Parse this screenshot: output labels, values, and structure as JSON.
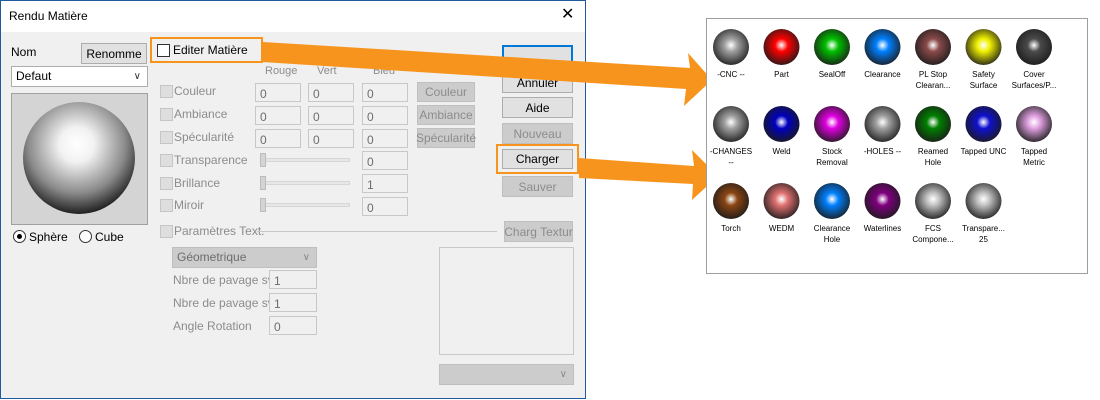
{
  "dialog": {
    "title": "Rendu Matière",
    "close_glyph": "✕",
    "name_label": "Nom",
    "rename_button": "Renomme",
    "name_select_value": "Defaut",
    "edit_checkbox_label": "Editer Matière",
    "col_headers": [
      "Rouge",
      "Vert",
      "Bleu"
    ],
    "rows": [
      {
        "label": "Couleur",
        "values": [
          "0",
          "0",
          "0"
        ],
        "button": "Couleur"
      },
      {
        "label": "Ambiance",
        "values": [
          "0",
          "0",
          "0"
        ],
        "button": "Ambiance"
      },
      {
        "label": "Spécularité",
        "values": [
          "0",
          "0",
          "0"
        ],
        "button": "Spécularité"
      }
    ],
    "sliders": [
      {
        "label": "Transparence",
        "value": "0"
      },
      {
        "label": "Brillance",
        "value": "1"
      },
      {
        "label": "Miroir",
        "value": "0"
      }
    ],
    "buttons": {
      "ok": "",
      "cancel": "Annuler",
      "help": "Aide",
      "new": "Nouveau",
      "load": "Charger",
      "save": "Sauver",
      "load_texture": "Charg Textur"
    },
    "texture_label": "Paramètres Text.",
    "texture_type": "Géometrique",
    "texture_fields": [
      {
        "label": "Nbre de pavage svt",
        "value": "1"
      },
      {
        "label": "Nbre de pavage svt",
        "value": "1"
      },
      {
        "label": "Angle Rotation",
        "value": "0"
      }
    ],
    "preview_options": {
      "sphere": "Sphère",
      "cube": "Cube",
      "selected": "sphere"
    }
  },
  "palette": {
    "swatches": [
      {
        "label1": "-CNC --",
        "label2": "",
        "color": "#a0a0a0"
      },
      {
        "label1": "Part",
        "label2": "",
        "color": "#ff0000"
      },
      {
        "label1": "SealOff",
        "label2": "",
        "color": "#00c000"
      },
      {
        "label1": "Clearance",
        "label2": "",
        "color": "#0080ff"
      },
      {
        "label1": "PL Stop",
        "label2": "Clearan...",
        "color": "#8b4a4a"
      },
      {
        "label1": "Safety",
        "label2": "Surface",
        "color": "#f0f000"
      },
      {
        "label1": "Cover",
        "label2": "Surfaces/P...",
        "color": "#4a4a4a"
      },
      {
        "label1": "-CHANGES",
        "label2": "--",
        "color": "#a0a0a0"
      },
      {
        "label1": "Weld",
        "label2": "",
        "color": "#0000c0"
      },
      {
        "label1": "Stock",
        "label2": "Removal",
        "color": "#e000e0"
      },
      {
        "label1": "-HOLES --",
        "label2": "",
        "color": "#a0a0a0"
      },
      {
        "label1": "Reamed",
        "label2": "Hole",
        "color": "#008000"
      },
      {
        "label1": "Tapped UNC",
        "label2": "",
        "color": "#1010d0"
      },
      {
        "label1": "Tapped",
        "label2": "Metric",
        "color": "#e0a0e0"
      },
      {
        "label1": "Torch",
        "label2": "",
        "color": "#8b4513"
      },
      {
        "label1": "WEDM",
        "label2": "",
        "color": "#e07070"
      },
      {
        "label1": "Clearance",
        "label2": "Hole",
        "color": "#0080ff"
      },
      {
        "label1": "Waterlines",
        "label2": "",
        "color": "#800080"
      },
      {
        "label1": "FCS",
        "label2": "Compone...",
        "color": "#c0c0c0"
      },
      {
        "label1": "Transpare...",
        "label2": "25",
        "color": "#c0c0c0"
      }
    ]
  },
  "colors": {
    "highlight": "#f7941d",
    "arrow": "#f7941d",
    "dialog_bg": "#f0f0f0",
    "accent": "#0078d7"
  }
}
